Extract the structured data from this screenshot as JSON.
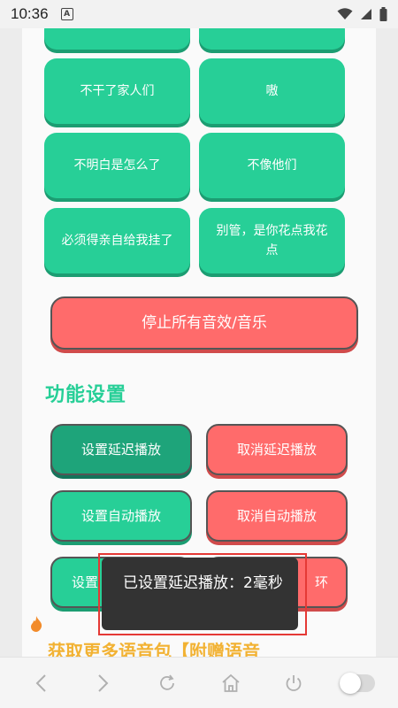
{
  "status_bar": {
    "time": "10:36",
    "notification_icon_glyph": "A"
  },
  "sound_buttons": [
    {
      "label": ""
    },
    {
      "label": ""
    },
    {
      "label": "不干了家人们"
    },
    {
      "label": "嗷"
    },
    {
      "label": "不明白是怎么了"
    },
    {
      "label": "不像他们"
    },
    {
      "label": "必须得亲自给我挂了"
    },
    {
      "label": "别管，是你花点我花点"
    }
  ],
  "stop_all_label": "停止所有音效/音乐",
  "settings": {
    "title": "功能设置",
    "set_delay_label": "设置延迟播放",
    "cancel_delay_label": "取消延迟播放",
    "set_auto_label": "设置自动播放",
    "cancel_auto_label": "取消自动播放",
    "set_loop_label": "设置",
    "cancel_loop_label": "环"
  },
  "more_title": "获取更多语音包【附赠语音",
  "toast": {
    "message": "已设置延迟播放：2毫秒"
  },
  "colors": {
    "accent_green": "#27cf97",
    "accent_red": "#ff6b6b",
    "accent_orange": "#f2b233"
  }
}
